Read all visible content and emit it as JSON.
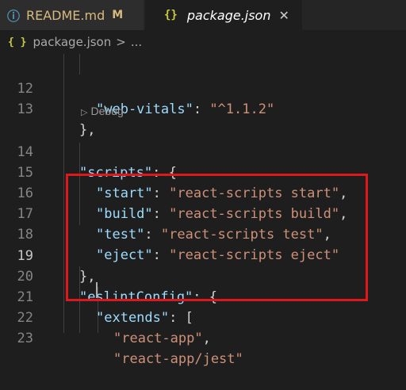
{
  "tabs": [
    {
      "label": "README.md",
      "icon": "info-icon",
      "badge": "M",
      "active": false
    },
    {
      "label": "package.json",
      "icon": "json-braces-icon",
      "close": "✕",
      "active": true
    }
  ],
  "breadcrumb": {
    "icon": "{ }",
    "file": "package.json",
    "separator": ">",
    "more": "..."
  },
  "codelens": {
    "label": "Debug"
  },
  "lines": [
    {
      "num": "12",
      "k": "\"web-vitals\"",
      "mid": ": ",
      "s": "\"^1.1.2\"",
      "end": ""
    },
    {
      "num": "13",
      "p": "},"
    },
    {
      "num": "14",
      "k": "\"scripts\"",
      "mid": ": {",
      "s": "",
      "end": ""
    },
    {
      "num": "15",
      "k": "\"start\"",
      "mid": ": ",
      "s": "\"react-scripts start\"",
      "end": ","
    },
    {
      "num": "16",
      "k": "\"build\"",
      "mid": ": ",
      "s": "\"react-scripts build\"",
      "end": ","
    },
    {
      "num": "17",
      "k": "\"test\"",
      "mid": ": ",
      "s": "\"react-scripts test\"",
      "end": ","
    },
    {
      "num": "18",
      "k": "\"eject\"",
      "mid": ": ",
      "s": "\"react-scripts eject\"",
      "end": ""
    },
    {
      "num": "19",
      "p": "},"
    },
    {
      "num": "20",
      "k": "\"eslintConfig\"",
      "mid": ": {",
      "s": "",
      "end": ""
    },
    {
      "num": "21",
      "k": "\"extends\"",
      "mid": ": [",
      "s": "",
      "end": ""
    },
    {
      "num": "22",
      "s": "\"react-app\"",
      "end": ","
    },
    {
      "num": "23",
      "s": "\"react-app/jest\"",
      "end": ""
    }
  ],
  "colors": {
    "highlight": "#e0181c",
    "key": "#9cdcfe",
    "string": "#ce9178"
  }
}
